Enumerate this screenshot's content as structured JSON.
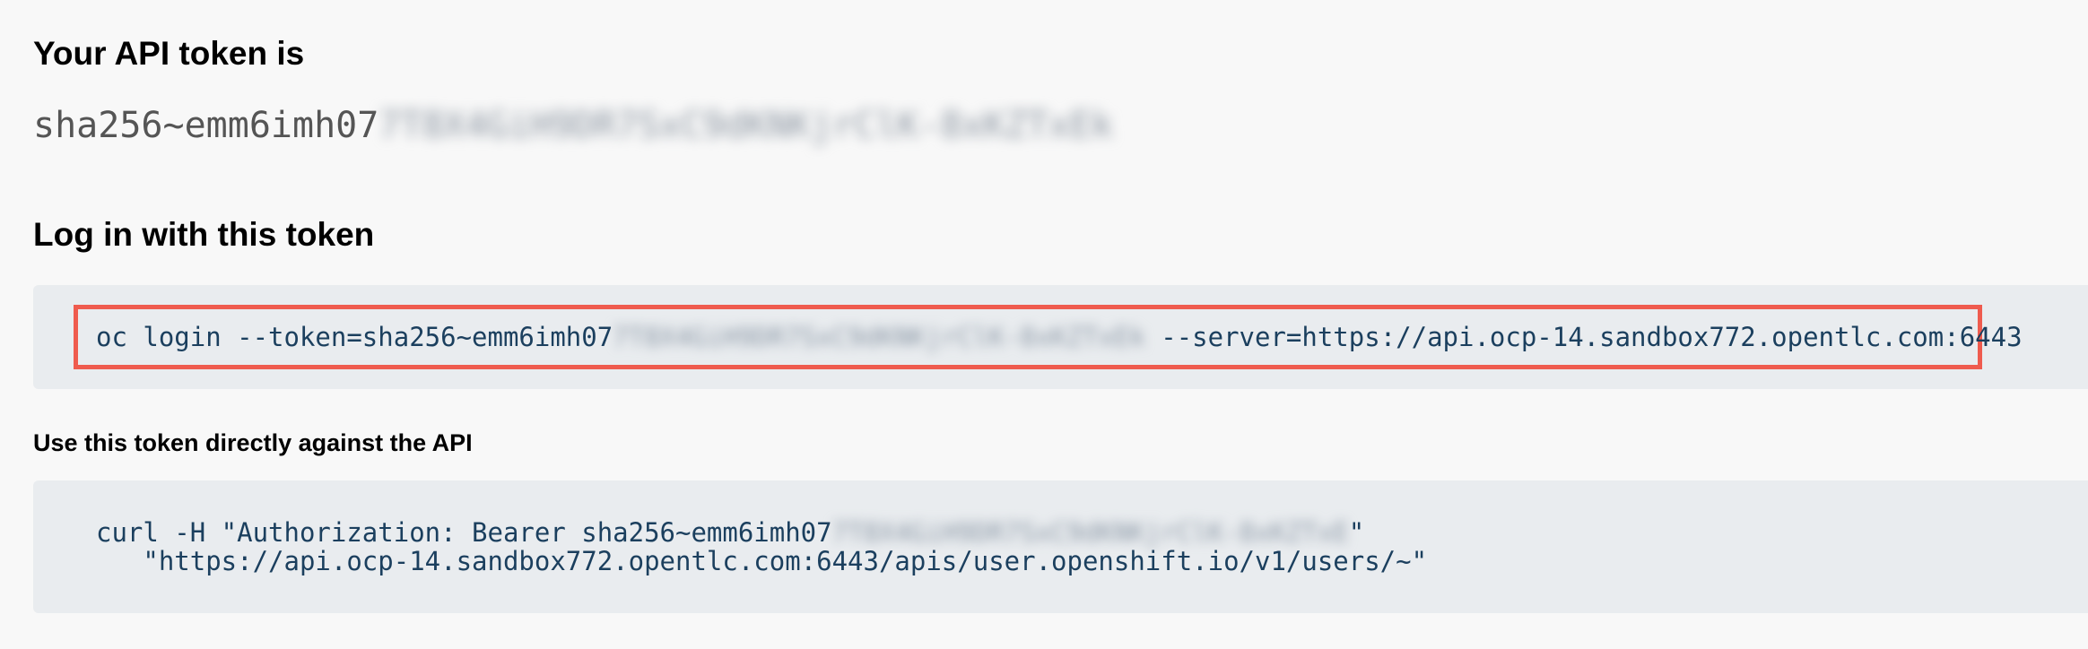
{
  "token_section": {
    "heading": "Your API token is",
    "token_visible": "sha256~emm6imh07",
    "token_redacted": "7T8X4GiH9DR7SxC9dKNKjrClK-8xKZTxEk"
  },
  "login_section": {
    "heading": "Log in with this token",
    "command_prefix": "oc login --token=sha256~emm6imh07",
    "command_redacted": "7T8X4GiH9DR7SxC9dKNKjrClK-8xKZTxEk",
    "command_suffix": " --server=https://api.ocp-14.sandbox772.opentlc.com:6443",
    "highlight_color": "#ef5b4e"
  },
  "api_section": {
    "heading": "Use this token directly against the API",
    "curl_line1_prefix": "curl -H \"Authorization: Bearer sha256~emm6imh07",
    "curl_line1_redacted": "7T8X4GiH9DR7SxC9dKNKjrClK-8xKZTxE",
    "curl_line1_suffix": "\"",
    "curl_line2": "   \"https://api.ocp-14.sandbox772.opentlc.com:6443/apis/user.openshift.io/v1/users/~\""
  }
}
